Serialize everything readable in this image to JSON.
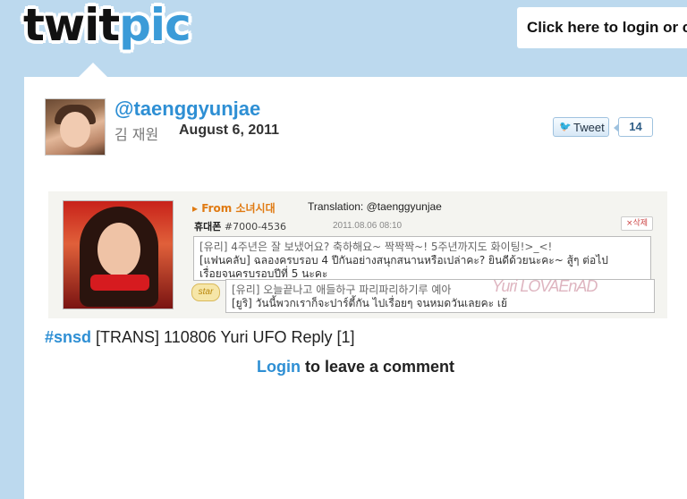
{
  "header": {
    "logo_twit": "twit",
    "logo_pic": "pic",
    "login_prompt": "Click here to login or c"
  },
  "post": {
    "username": "@taenggyunjae",
    "real_name": "김 재원",
    "date": "August 6, 2011",
    "tweet_label": "Tweet",
    "tweet_count": "14",
    "tag": "#snsd",
    "caption_text": " [TRANS] 110806 Yuri UFO Reply [1]"
  },
  "image": {
    "from_label": "▸ From 소녀시대",
    "translation_credit": "Translation: @taenggyunjae",
    "phone_label": "휴대폰",
    "phone_id": "#7000-4536",
    "timestamp": "2011.08.06 08:10",
    "delete_label": "×삭제",
    "message_line_1": "[유리] 4주년은 잘 보냈어요? 축하해요~ 짝짝짝~! 5주년까지도 화이팅!>_<!",
    "message_line_2": "[แฟนคลับ] ฉลองครบรอบ 4 ปีกันอย่างสนุกสนานหรือเปล่าคะ? ยินดีด้วยนะคะ~ สู้ๆ ต่อไป",
    "message_line_3": "เรื่อยจนครบรอบปีที่ 5 นะคะ",
    "star_label": "star",
    "reply_line_1": "[유리] 오늘끝나고 애들하구 파리파리하기루 예아",
    "reply_line_2": "[ยูริ] วันนี้พวกเราก็จะปาร์ตี้กัน ไปเรื่อยๆ จนหมดวันเลยคะ เย้",
    "watermark": "Yuri LOVAEnAD"
  },
  "comments": {
    "login_link": "Login",
    "login_suffix": " to leave a comment"
  }
}
